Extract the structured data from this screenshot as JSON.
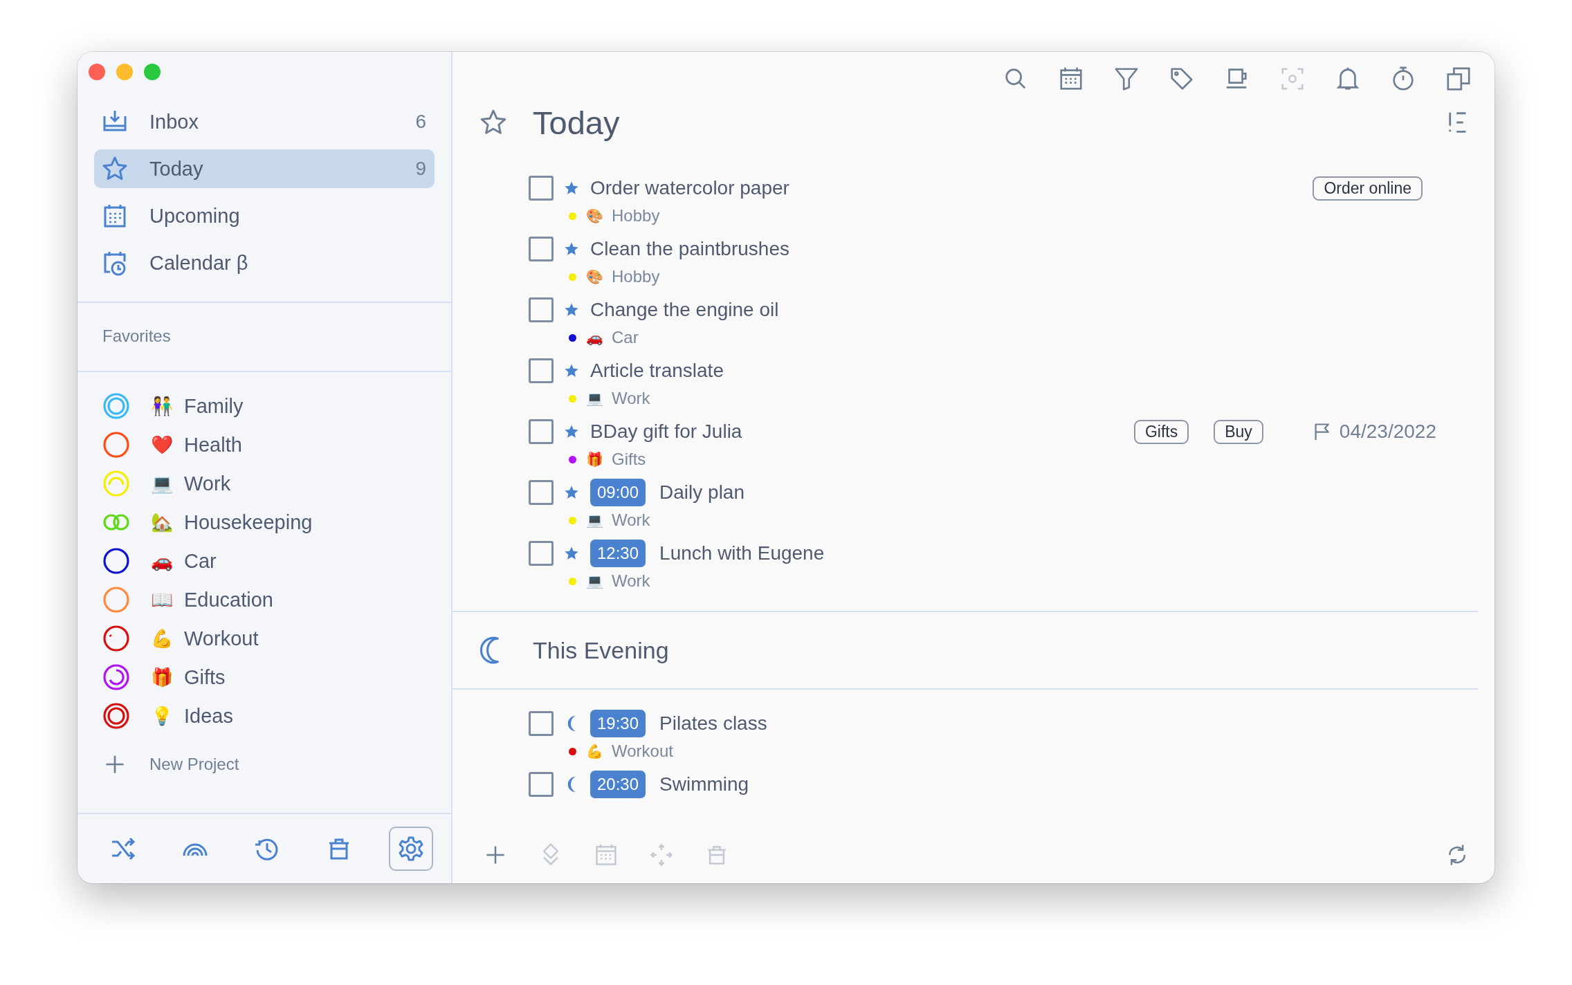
{
  "sidebar": {
    "nav": [
      {
        "label": "Inbox",
        "count": "6",
        "selected": false
      },
      {
        "label": "Today",
        "count": "9",
        "selected": true
      },
      {
        "label": "Upcoming",
        "selected": false
      },
      {
        "label": "Calendar β",
        "selected": false
      }
    ],
    "favorites_title": "Favorites",
    "projects": [
      {
        "kind": "double",
        "color": "#3ab8f5",
        "emoji": "👫",
        "name": "Family"
      },
      {
        "kind": "ring",
        "color": "#ff4a12",
        "emoji": "❤️",
        "name": "Health"
      },
      {
        "kind": "arc",
        "color": "#f5ee00",
        "emoji": "💻",
        "name": "Work"
      },
      {
        "kind": "pair",
        "color": "#5fd81c",
        "emoji": "🏡",
        "name": "Housekeeping"
      },
      {
        "kind": "ring",
        "color": "#1010d0",
        "emoji": "🚗",
        "name": "Car"
      },
      {
        "kind": "ring",
        "color": "#ff8a3c",
        "emoji": "📖",
        "name": "Education"
      },
      {
        "kind": "tick",
        "color": "#d80f0f",
        "emoji": "💪",
        "name": "Workout"
      },
      {
        "kind": "spiral",
        "color": "#b012f5",
        "emoji": "🎁",
        "name": "Gifts"
      },
      {
        "kind": "double",
        "color": "#d80f0f",
        "emoji": "💡",
        "name": "Ideas"
      }
    ],
    "new_project": "New Project",
    "footer_tools": [
      {
        "selected": false
      },
      {
        "selected": false
      },
      {
        "selected": false
      },
      {
        "selected": false
      },
      {
        "selected": true
      }
    ]
  },
  "toolbar": [
    {
      "disabled": false
    },
    {
      "disabled": false
    },
    {
      "disabled": false
    },
    {
      "disabled": false
    },
    {
      "disabled": false
    },
    {
      "disabled": true
    },
    {
      "disabled": false
    },
    {
      "disabled": false
    },
    {
      "disabled": false
    }
  ],
  "sections": [
    {
      "kind": "today",
      "title": "Today",
      "tasks": [
        {
          "checked": false,
          "kind": "star",
          "title": "Order watercolor paper",
          "project": {
            "color": "#f5ee00",
            "emoji": "🎨",
            "name": "Hobby"
          },
          "tags": [
            "Order online"
          ]
        },
        {
          "checked": false,
          "kind": "star",
          "title": "Clean the paintbrushes",
          "project": {
            "color": "#f5ee00",
            "emoji": "🎨",
            "name": "Hobby"
          }
        },
        {
          "checked": false,
          "kind": "star",
          "title": "Change the engine oil",
          "project": {
            "color": "#1010d0",
            "emoji": "🚗",
            "name": "Car"
          }
        },
        {
          "checked": false,
          "kind": "star",
          "title": "Article translate",
          "project": {
            "color": "#f5ee00",
            "emoji": "💻",
            "name": "Work"
          }
        },
        {
          "checked": false,
          "kind": "star",
          "title": "BDay gift for Julia",
          "project": {
            "color": "#b012f5",
            "emoji": "🎁",
            "name": "Gifts"
          },
          "tags": [
            "Gifts",
            "Buy"
          ],
          "deadline": "04/23/2022"
        },
        {
          "checked": false,
          "kind": "star",
          "time": "09:00",
          "title": "Daily plan",
          "project": {
            "color": "#f5ee00",
            "emoji": "💻",
            "name": "Work"
          }
        },
        {
          "checked": false,
          "kind": "star",
          "time": "12:30",
          "title": "Lunch with Eugene",
          "project": {
            "color": "#f5ee00",
            "emoji": "💻",
            "name": "Work"
          }
        }
      ]
    },
    {
      "kind": "evening",
      "title": "This Evening",
      "tasks": [
        {
          "checked": false,
          "kind": "moon",
          "time": "19:30",
          "title": "Pilates class",
          "project": {
            "color": "#d80f0f",
            "emoji": "💪",
            "name": "Workout"
          }
        },
        {
          "checked": false,
          "kind": "moon",
          "time": "20:30",
          "title": "Swimming"
        }
      ]
    }
  ],
  "bottom_tools": [
    {
      "disabled": false
    },
    {
      "disabled": true
    },
    {
      "disabled": true
    },
    {
      "disabled": true
    },
    {
      "disabled": true
    },
    {
      "disabled": false
    }
  ]
}
